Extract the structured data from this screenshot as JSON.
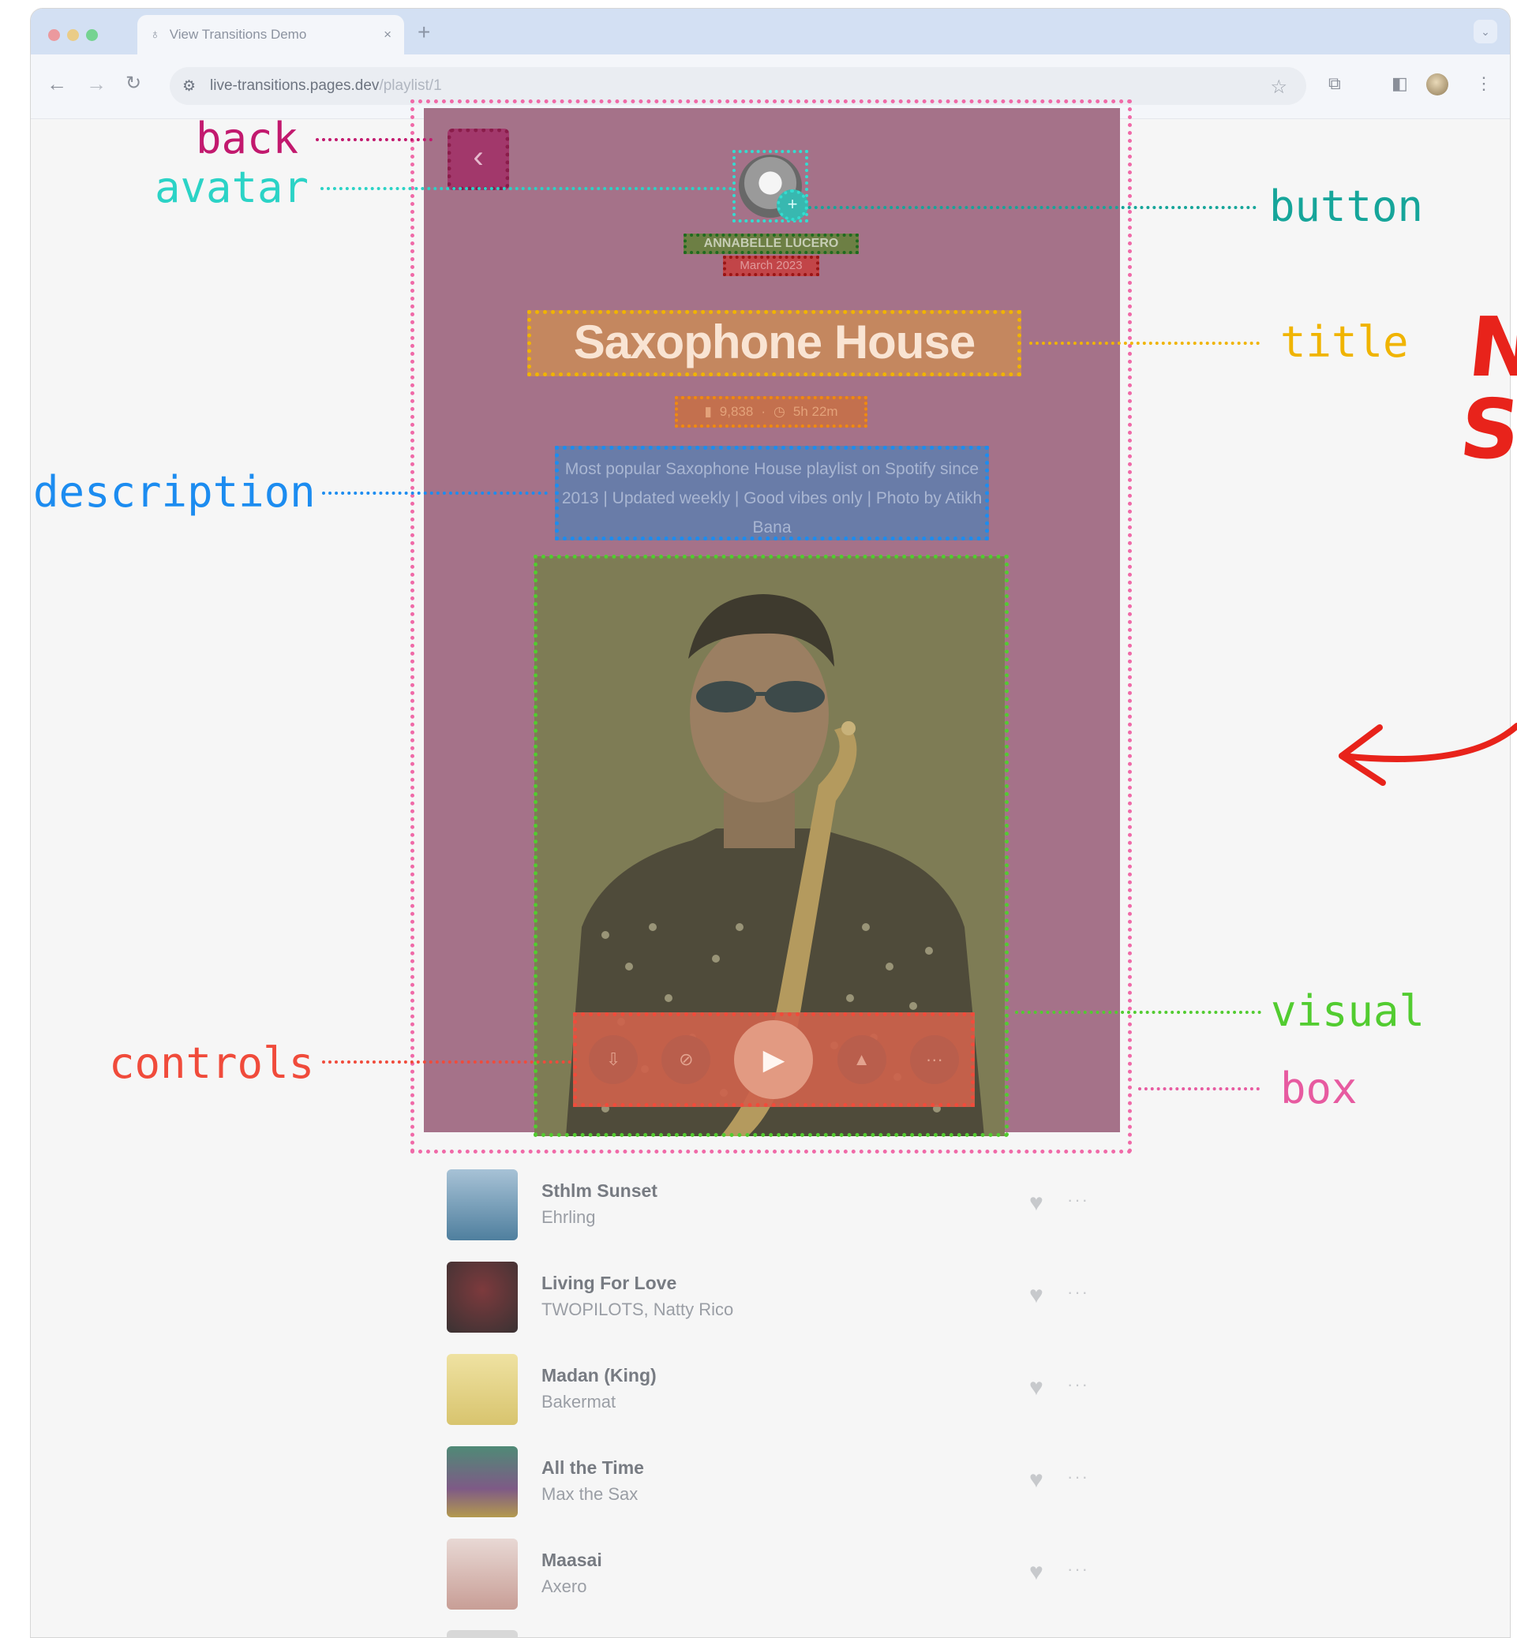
{
  "browser": {
    "tab_title": "View Transitions Demo",
    "tab_close": "×",
    "new_tab": "+",
    "url_host": "live-transitions.pages.dev",
    "url_path": "/playlist/1"
  },
  "playlist": {
    "back_glyph": "‹",
    "add_glyph": "+",
    "author": "ANNABELLE LUCERO",
    "date": "March 2023",
    "title": "Saxophone House",
    "plays": "9,838",
    "duration": "5h 22m",
    "stats_separator": "·",
    "description": "Most popular Saxophone House playlist on Spotify since 2013 | Updated weekly | Good vibes only | Photo by Atikh Bana"
  },
  "annotations": {
    "back": "back",
    "avatar": "avatar",
    "button": "button",
    "title": "title",
    "description": "description",
    "visual": "visual",
    "controls": "controls",
    "box": "box"
  },
  "cut_text": {
    "line1": "N",
    "line2": "Sı"
  },
  "tracks": [
    {
      "name": "Sthlm Sunset",
      "artist": "Ehrling",
      "thumb_color": "#5f8fb0"
    },
    {
      "name": "Living For Love",
      "artist": "TWOPILOTS, Natty Rico",
      "thumb_color": "#4a3c3e"
    },
    {
      "name": "Madan (King)",
      "artist": "Bakermat",
      "thumb_color": "#e6d38a"
    },
    {
      "name": "All the Time",
      "artist": "Max the Sax",
      "thumb_color": "#6e5f86"
    },
    {
      "name": "Maasai",
      "artist": "Axero",
      "thumb_color": "#d8b8b0"
    }
  ],
  "track_more": "···",
  "colors": {
    "back": "#c2196e",
    "avatar": "#2bd3c6",
    "button": "#16a59a",
    "title": "#f0b400",
    "description": "#1c8cf0",
    "visual": "#52cc30",
    "controls": "#f04b3b",
    "box": "#e75aa0",
    "cut_text": "#e8231b"
  }
}
